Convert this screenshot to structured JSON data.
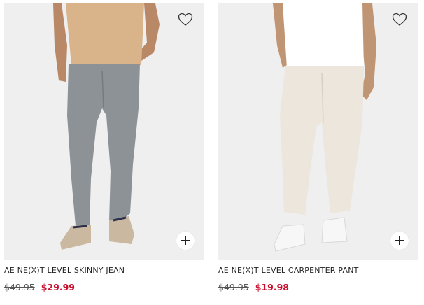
{
  "products": [
    {
      "name": "AE NE(X)T LEVEL SKINNY JEAN",
      "original_price": "$49.95",
      "sale_price": "$29.99",
      "image_icon": "product-photo-grey-skinny-jeans",
      "favorite_icon": "heart-outline-icon",
      "quick_add_icon": "plus-icon"
    },
    {
      "name": "AE NE(X)T LEVEL CARPENTER PANT",
      "original_price": "$49.95",
      "sale_price": "$19.98",
      "image_icon": "product-photo-white-carpenter-pants",
      "favorite_icon": "heart-outline-icon",
      "quick_add_icon": "plus-icon"
    }
  ],
  "colors": {
    "sale_price": "#c8102e",
    "image_background": "#efefef"
  }
}
